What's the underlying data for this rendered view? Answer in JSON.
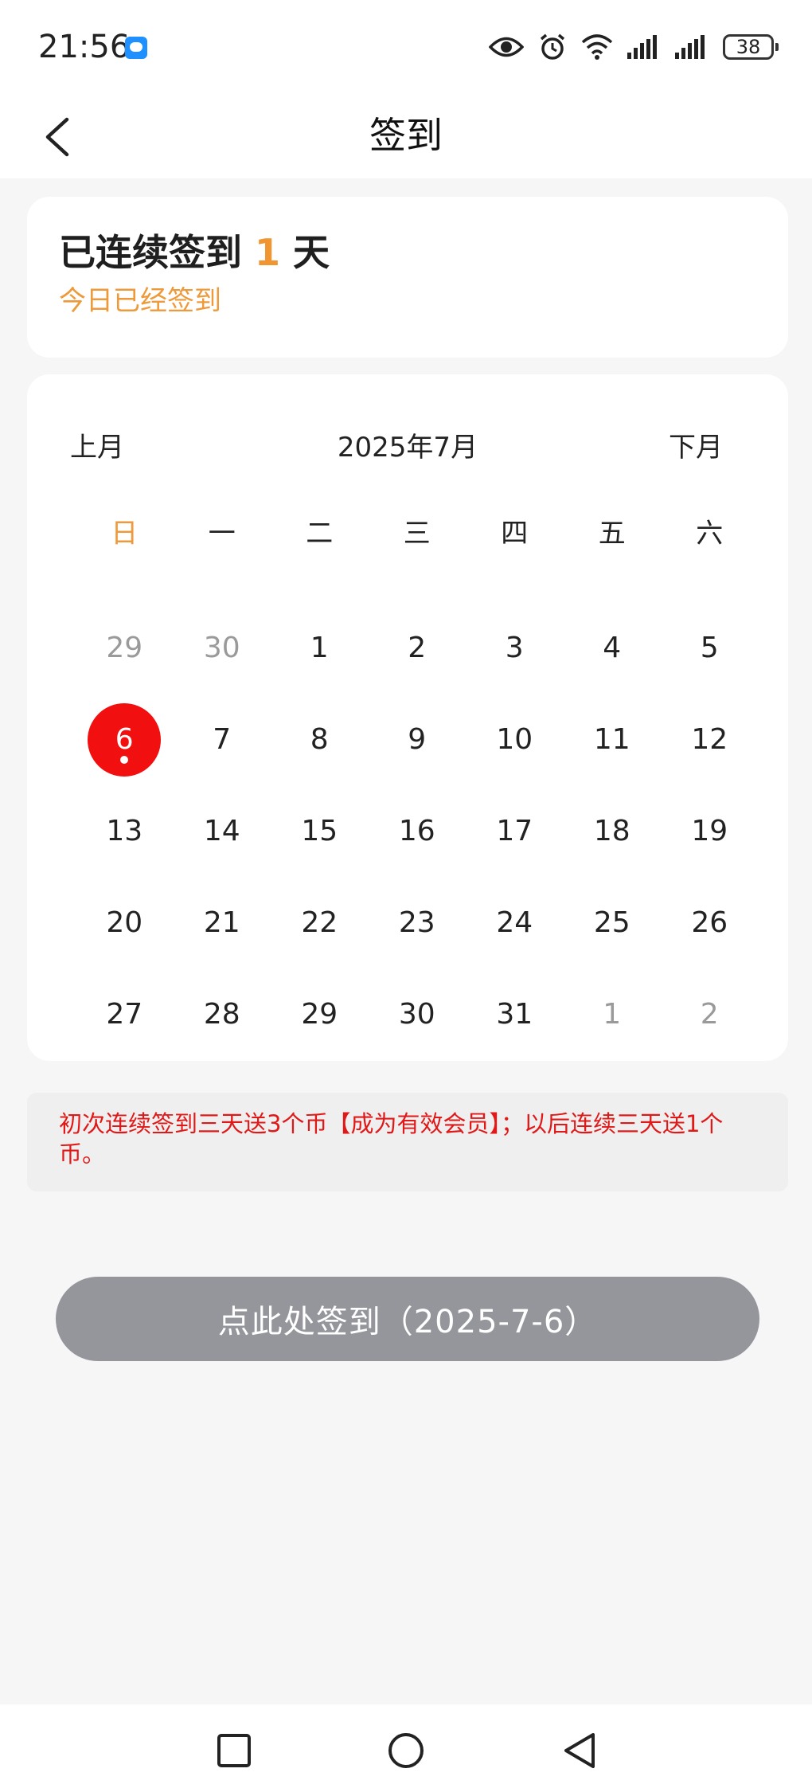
{
  "status_bar": {
    "time": "21:56",
    "battery": "38"
  },
  "app_bar": {
    "title": "签到"
  },
  "streak": {
    "prefix": "已连续签到",
    "count": "1",
    "suffix": "天",
    "today_status": "今日已经签到"
  },
  "calendar": {
    "prev_label": "上月",
    "next_label": "下月",
    "month_title": "2025年7月",
    "weekdays": [
      "日",
      "一",
      "二",
      "三",
      "四",
      "五",
      "六"
    ],
    "weeks": [
      [
        "29",
        "30",
        "1",
        "2",
        "3",
        "4",
        "5"
      ],
      [
        "6",
        "7",
        "8",
        "9",
        "10",
        "11",
        "12"
      ],
      [
        "13",
        "14",
        "15",
        "16",
        "17",
        "18",
        "19"
      ],
      [
        "20",
        "21",
        "22",
        "23",
        "24",
        "25",
        "26"
      ],
      [
        "27",
        "28",
        "29",
        "30",
        "31",
        "1",
        "2"
      ]
    ],
    "selected_day": "6"
  },
  "notice": {
    "text": "初次连续签到三天送3个币【成为有效会员】；以后连续三天送1个币。"
  },
  "signin_button": {
    "label": "点此处签到（2025-7-6）"
  },
  "colors": {
    "accent_orange": "#f0952f",
    "selected_red": "#f20f0f",
    "notice_red": "#e01818",
    "button_gray": "#94969b"
  }
}
